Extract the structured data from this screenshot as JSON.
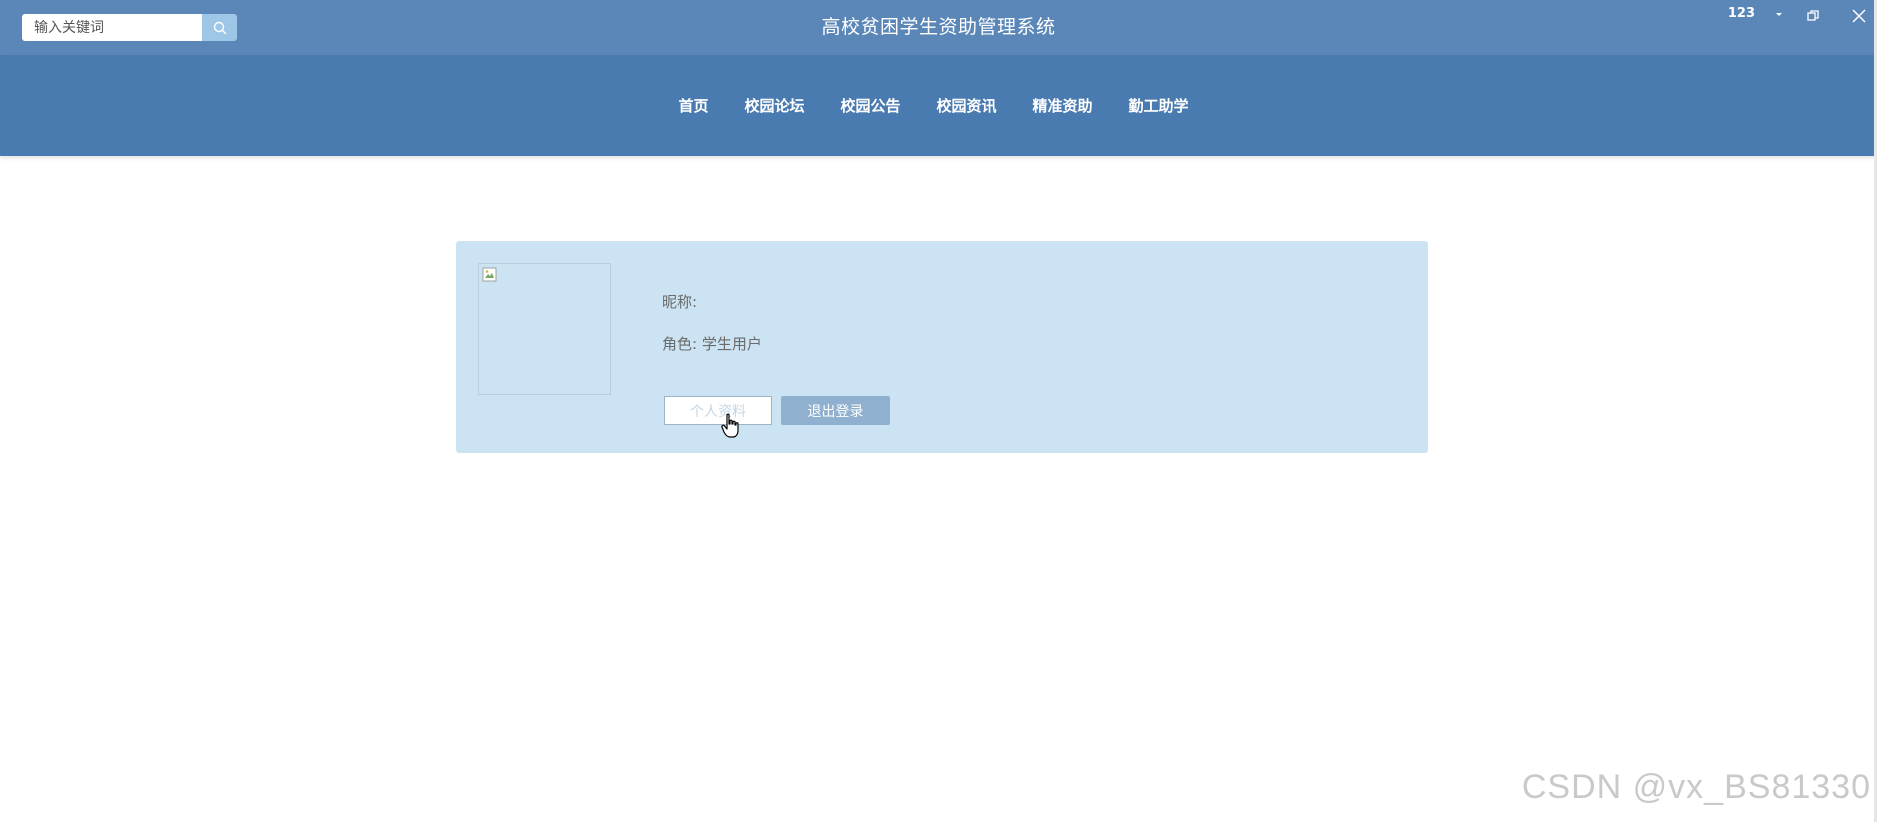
{
  "header": {
    "title": "高校贫困学生资助管理系统",
    "search": {
      "placeholder": "输入关键词",
      "value": ""
    },
    "window": {
      "user": "123"
    }
  },
  "nav": {
    "items": [
      {
        "label": "首页"
      },
      {
        "label": "校园论坛"
      },
      {
        "label": "校园公告"
      },
      {
        "label": "校园资讯"
      },
      {
        "label": "精准资助"
      },
      {
        "label": "勤工助学"
      }
    ]
  },
  "profile": {
    "nickname_label": "昵称:",
    "role_label": "角色: 学生用户",
    "profile_button": "个人资料",
    "logout_button": "退出登录"
  },
  "watermark": "CSDN @vx_BS81330",
  "colors": {
    "topbar": "#5b87b8",
    "navbar": "#4a7bb0",
    "card": "#cbe3f2",
    "logout_button": "#8fb0cf",
    "search_button": "#9ec6e6"
  }
}
